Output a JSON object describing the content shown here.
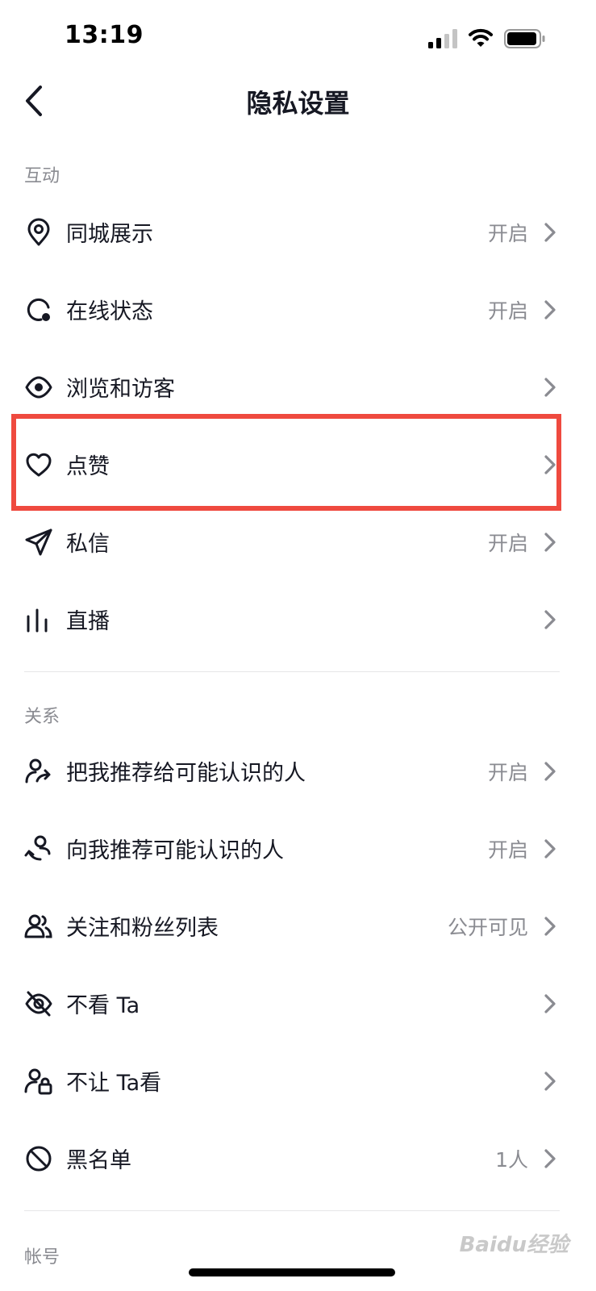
{
  "status_bar": {
    "time": "13:19"
  },
  "nav": {
    "title": "隐私设置"
  },
  "sections": {
    "interaction": {
      "header": "互动",
      "items": [
        {
          "label": "同城展示",
          "value": "开启"
        },
        {
          "label": "在线状态",
          "value": "开启"
        },
        {
          "label": "浏览和访客",
          "value": ""
        },
        {
          "label": "点赞",
          "value": ""
        },
        {
          "label": "私信",
          "value": "开启"
        },
        {
          "label": "直播",
          "value": ""
        }
      ]
    },
    "relationship": {
      "header": "关系",
      "items": [
        {
          "label": "把我推荐给可能认识的人",
          "value": "开启"
        },
        {
          "label": "向我推荐可能认识的人",
          "value": "开启"
        },
        {
          "label": "关注和粉丝列表",
          "value": "公开可见"
        },
        {
          "label": "不看 Ta",
          "value": ""
        },
        {
          "label": "不让 Ta看",
          "value": ""
        },
        {
          "label": "黑名单",
          "value": "1人"
        }
      ]
    },
    "account": {
      "header": "帐号"
    }
  },
  "watermark": "Baidu经验",
  "colors": {
    "highlight": "#ef4a3f",
    "text": "#161823",
    "secondary": "#8a8b91"
  }
}
